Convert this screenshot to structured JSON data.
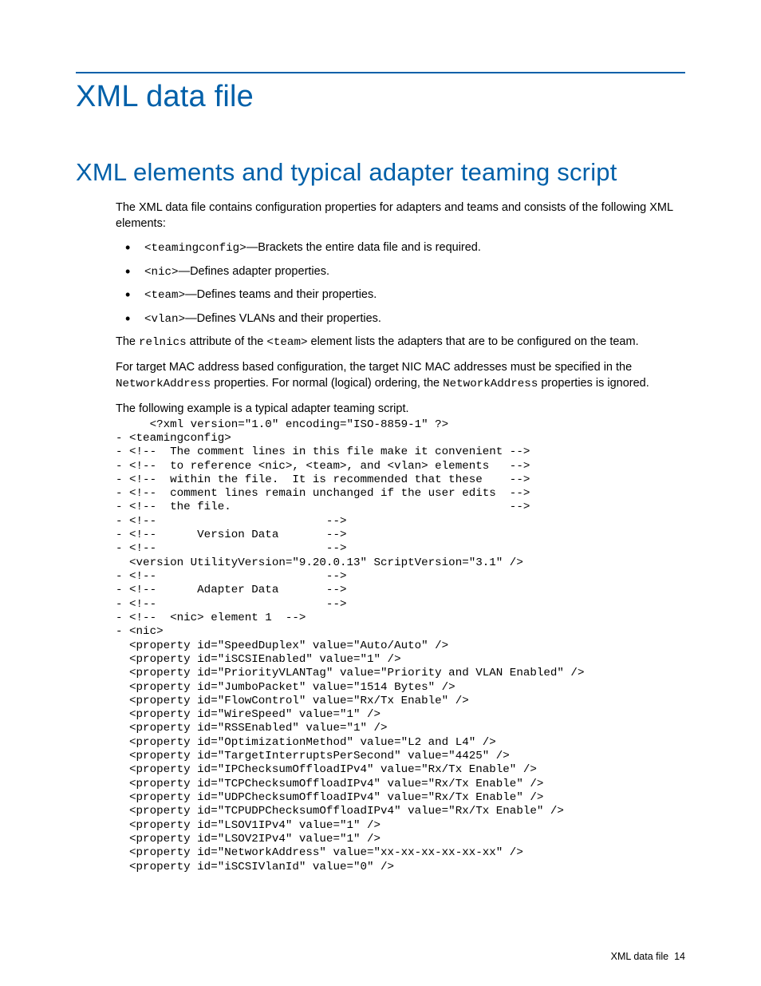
{
  "title": "XML data file",
  "subtitle": "XML elements and typical adapter teaming script",
  "intro": "The XML data file contains configuration properties for adapters and teams and consists of the following XML elements:",
  "bullets": [
    {
      "code": "<teamingconfig>",
      "desc": "—Brackets the entire data file and is required."
    },
    {
      "code": "<nic>",
      "desc": "—Defines adapter properties."
    },
    {
      "code": "<team>",
      "desc": "—Defines teams and their properties."
    },
    {
      "code": "<vlan>",
      "desc": "—Defines VLANs and their properties."
    }
  ],
  "para2_a": "The ",
  "para2_code1": "relnics",
  "para2_b": " attribute of the ",
  "para2_code2": "<team>",
  "para2_c": " element lists the adapters that are to be configured on the team.",
  "para3_a": "For target MAC address based configuration, the target NIC MAC addresses must be specified in the ",
  "para3_code1": "NetworkAddress",
  "para3_b": " properties. For normal (logical) ordering, the ",
  "para3_code2": "NetworkAddress",
  "para3_c": " properties is ignored.",
  "para4": "The following example is a typical adapter teaming script.",
  "code": "     <?xml version=\"1.0\" encoding=\"ISO-8859-1\" ?>\n- <teamingconfig>\n- <!--  The comment lines in this file make it convenient -->\n- <!--  to reference <nic>, <team>, and <vlan> elements   -->\n- <!--  within the file.  It is recommended that these    -->\n- <!--  comment lines remain unchanged if the user edits  -->\n- <!--  the file.                                         -->\n- <!--                         -->\n- <!--      Version Data       -->\n- <!--                         -->\n  <version UtilityVersion=\"9.20.0.13\" ScriptVersion=\"3.1\" />\n- <!--                         -->\n- <!--      Adapter Data       -->\n- <!--                         -->\n- <!--  <nic> element 1  -->\n- <nic>\n  <property id=\"SpeedDuplex\" value=\"Auto/Auto\" />\n  <property id=\"iSCSIEnabled\" value=\"1\" />\n  <property id=\"PriorityVLANTag\" value=\"Priority and VLAN Enabled\" />\n  <property id=\"JumboPacket\" value=\"1514 Bytes\" />\n  <property id=\"FlowControl\" value=\"Rx/Tx Enable\" />\n  <property id=\"WireSpeed\" value=\"1\" />\n  <property id=\"RSSEnabled\" value=\"1\" />\n  <property id=\"OptimizationMethod\" value=\"L2 and L4\" />\n  <property id=\"TargetInterruptsPerSecond\" value=\"4425\" />\n  <property id=\"IPChecksumOffloadIPv4\" value=\"Rx/Tx Enable\" />\n  <property id=\"TCPChecksumOffloadIPv4\" value=\"Rx/Tx Enable\" />\n  <property id=\"UDPChecksumOffloadIPv4\" value=\"Rx/Tx Enable\" />\n  <property id=\"TCPUDPChecksumOffloadIPv4\" value=\"Rx/Tx Enable\" />\n  <property id=\"LSOV1IPv4\" value=\"1\" />\n  <property id=\"LSOV2IPv4\" value=\"1\" />\n  <property id=\"NetworkAddress\" value=\"xx-xx-xx-xx-xx-xx\" />\n  <property id=\"iSCSIVlanId\" value=\"0\" />",
  "footer_label": "XML data file",
  "footer_page": "14"
}
